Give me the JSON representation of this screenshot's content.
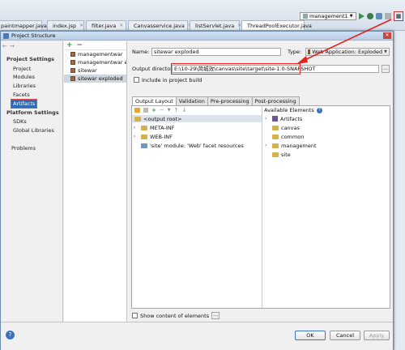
{
  "editor_tabs": [
    {
      "label": "paintmapper.java",
      "icon": "java-file-icon",
      "active": false
    },
    {
      "label": "index.jsp",
      "icon": "jsp-file-icon",
      "active": false
    },
    {
      "label": "filter.java",
      "icon": "java-file-icon",
      "active": false
    },
    {
      "label": "Canvasservice.java",
      "icon": "java-file-icon",
      "active": false
    },
    {
      "label": "listServlet.java",
      "icon": "java-file-icon",
      "active": false
    },
    {
      "label": "ThreadPoolExecutor.java",
      "icon": "java-file-icon",
      "active": true
    }
  ],
  "run_config": {
    "label": "management1"
  },
  "dialog": {
    "title": "Project Structure"
  },
  "left_nav": {
    "project_settings_header": "Project Settings",
    "project_settings": [
      "Project",
      "Modules",
      "Libraries",
      "Facets",
      "Artifacts"
    ],
    "platform_settings_header": "Platform Settings",
    "platform_settings": [
      "SDKs",
      "Global Libraries"
    ],
    "problems": "Problems",
    "selected": "Artifacts"
  },
  "artifacts": [
    "managementwar",
    "managementwar exploded",
    "sitewar",
    "sitewar exploded"
  ],
  "selected_artifact": "sitewar exploded",
  "detail": {
    "name_label": "Name:",
    "name_value": "sitewar exploded",
    "type_label": "Type:",
    "type_value": "Web Application: Exploded",
    "output_label": "Output directory:",
    "output_value": "E:\\10-29\\简城效\\canvas\\site\\target\\site-1.0-SNAPSHOT",
    "include_label": "Include in project build",
    "include_checked": false
  },
  "tabs": [
    "Output Layout",
    "Validation",
    "Pre-processing",
    "Post-processing"
  ],
  "active_tab": "Output Layout",
  "output_tree": [
    {
      "label": "<output root>",
      "expandable": false,
      "kind": "root"
    },
    {
      "label": "META-INF",
      "expandable": true,
      "kind": "folder"
    },
    {
      "label": "WEB-INF",
      "expandable": true,
      "kind": "folder"
    },
    {
      "label": "'site' module: 'Web' facet resources",
      "expandable": false,
      "kind": "facet"
    }
  ],
  "available_label": "Available Elements",
  "available_tree": [
    {
      "label": "Artifacts",
      "expandable": true,
      "kind": "artifacts"
    },
    {
      "label": "canvas",
      "expandable": false,
      "kind": "folder"
    },
    {
      "label": "common",
      "expandable": false,
      "kind": "folder"
    },
    {
      "label": "management",
      "expandable": true,
      "kind": "folder"
    },
    {
      "label": "site",
      "expandable": false,
      "kind": "folder"
    }
  ],
  "show_content_label": "Show content of elements",
  "buttons": {
    "ok": "OK",
    "cancel": "Cancel",
    "apply": "Apply"
  },
  "colors": {
    "selection": "#2f6cb3",
    "annotation_red": "#e22222"
  }
}
